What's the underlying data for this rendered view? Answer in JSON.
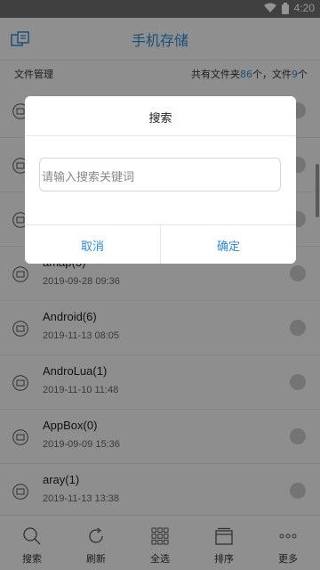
{
  "status": {
    "time": "4:20"
  },
  "appbar": {
    "title": "手机存储"
  },
  "subheader": {
    "left": "文件管理",
    "prefix": "共有文件夹",
    "folders": "86",
    "mid": "个，文件",
    "files": "9",
    "suffix": "个"
  },
  "list": [
    {
      "name": "amap(3)",
      "date": "2019-09-28 09:36"
    },
    {
      "name": "Android(6)",
      "date": "2019-11-13 08:05"
    },
    {
      "name": "AndroLua(1)",
      "date": "2019-11-10 11:48"
    },
    {
      "name": "AppBox(0)",
      "date": "2019-09-09 15:36"
    },
    {
      "name": "aray(1)",
      "date": "2019-11-13 13:38"
    }
  ],
  "nav": [
    {
      "label": "搜索",
      "icon": "search-icon"
    },
    {
      "label": "刷新",
      "icon": "refresh-icon"
    },
    {
      "label": "全选",
      "icon": "grid-icon"
    },
    {
      "label": "排序",
      "icon": "sort-icon"
    },
    {
      "label": "更多",
      "icon": "more-icon"
    }
  ],
  "dialog": {
    "title": "搜索",
    "placeholder": "请输入搜索关键词",
    "cancel": "取消",
    "ok": "确定"
  },
  "colors": {
    "accent": "#2f88d1"
  }
}
